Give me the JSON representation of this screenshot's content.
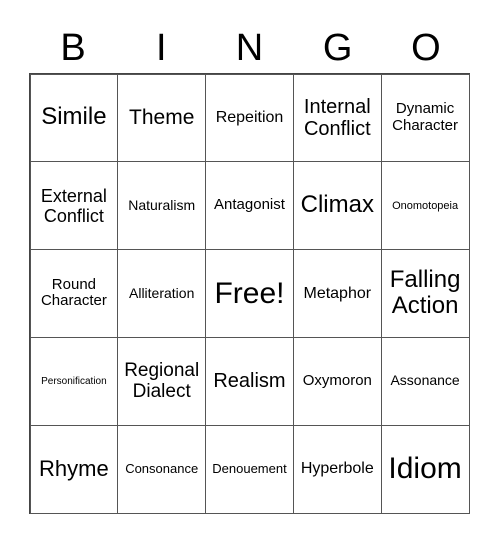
{
  "header": [
    "B",
    "I",
    "N",
    "G",
    "O"
  ],
  "cells": [
    [
      {
        "text": "Simile",
        "size": 24
      },
      {
        "text": "Theme",
        "size": 21
      },
      {
        "text": "Repeition",
        "size": 16
      },
      {
        "text": "Internal Conflict",
        "size": 20
      },
      {
        "text": "Dynamic Character",
        "size": 15
      }
    ],
    [
      {
        "text": "External Conflict",
        "size": 18
      },
      {
        "text": "Naturalism",
        "size": 14
      },
      {
        "text": "Antagonist",
        "size": 15
      },
      {
        "text": "Climax",
        "size": 24
      },
      {
        "text": "Onomotopeia",
        "size": 11
      }
    ],
    [
      {
        "text": "Round Character",
        "size": 15
      },
      {
        "text": "Alliteration",
        "size": 14
      },
      {
        "text": "Free!",
        "size": 30
      },
      {
        "text": "Metaphor",
        "size": 16
      },
      {
        "text": "Falling Action",
        "size": 24
      }
    ],
    [
      {
        "text": "Personification",
        "size": 10
      },
      {
        "text": "Regional Dialect",
        "size": 19
      },
      {
        "text": "Realism",
        "size": 20
      },
      {
        "text": "Oxymoron",
        "size": 15
      },
      {
        "text": "Assonance",
        "size": 14
      }
    ],
    [
      {
        "text": "Rhyme",
        "size": 22
      },
      {
        "text": "Consonance",
        "size": 13
      },
      {
        "text": "Denouement",
        "size": 13
      },
      {
        "text": "Hyperbole",
        "size": 16
      },
      {
        "text": "Idiom",
        "size": 30
      }
    ]
  ]
}
